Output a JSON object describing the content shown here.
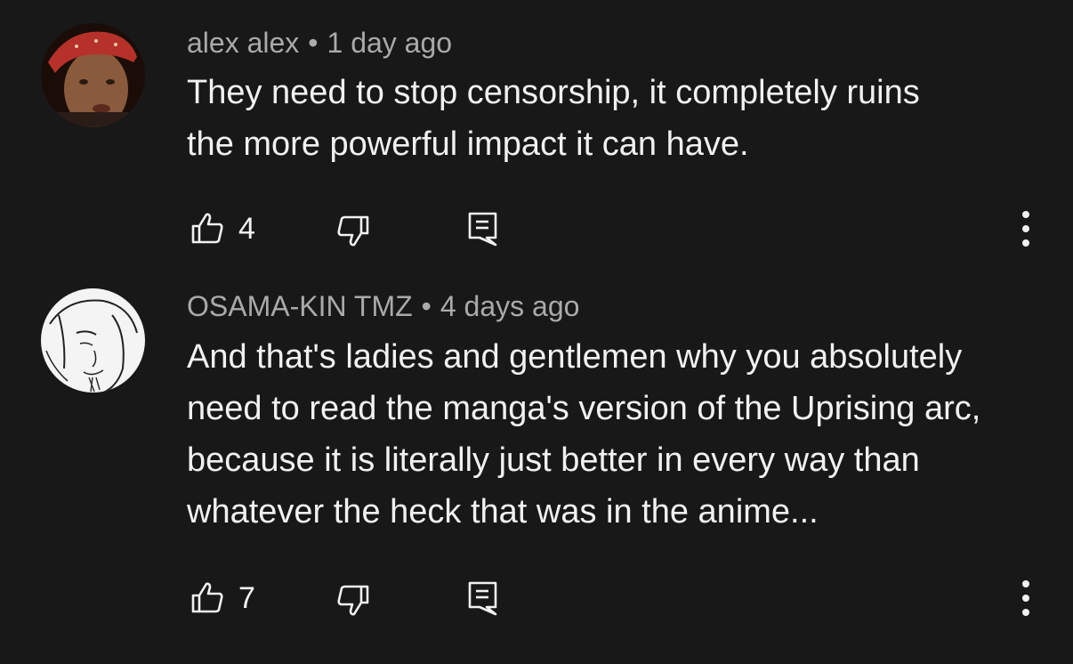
{
  "comments": [
    {
      "author": "alex alex",
      "time": "1 day ago",
      "lines": [
        "They need to stop censorship, it completely ruins",
        "the more powerful impact it can have."
      ],
      "likes": "4"
    },
    {
      "author": "OSAMA-KIN TMZ",
      "time": "4 days ago",
      "lines": [
        "And that's ladies and gentlemen why you absolutely",
        "need to read the manga's version of the Uprising arc,",
        "because it is literally just better in every way than",
        "whatever the heck that was in the anime..."
      ],
      "likes": "7"
    }
  ],
  "separator": "•",
  "icons": {
    "like": "thumbs-up-icon",
    "dislike": "thumbs-down-icon",
    "reply": "reply-comment-icon",
    "more": "more-vertical-icon"
  },
  "colors": {
    "background": "#181818",
    "text": "#f1f1f1",
    "meta": "#aaaaaa"
  }
}
